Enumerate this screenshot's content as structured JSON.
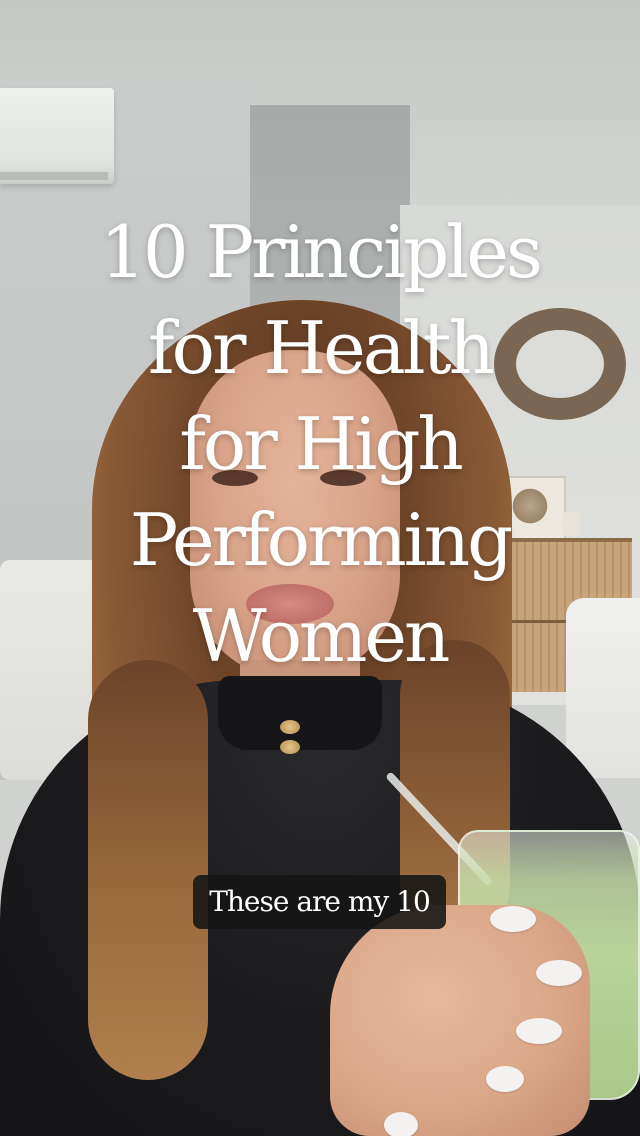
{
  "overlay": {
    "title_lines": [
      "10 Principles",
      "for Health",
      "for High",
      "Performing",
      "Women"
    ],
    "caption": "These are my 10"
  }
}
